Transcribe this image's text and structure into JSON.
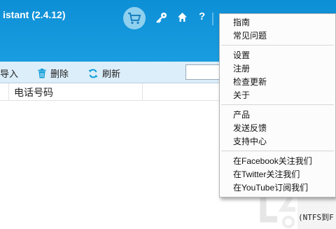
{
  "window": {
    "title": "istant (2.4.12)"
  },
  "header": {
    "icons": [
      "cart-icon",
      "key-icon",
      "home-icon",
      "help-icon"
    ],
    "help_label": "?"
  },
  "toolbar": {
    "import_label": "导入",
    "delete_label": "删除",
    "refresh_label": "刷新"
  },
  "table": {
    "columns": [
      "电话号码"
    ]
  },
  "menu": {
    "groups": [
      [
        "指南",
        "常见问题"
      ],
      [
        "设置",
        "注册",
        "检查更新",
        "关于"
      ],
      [
        "产品",
        "发送反馈",
        "支持中心"
      ],
      [
        "在Facebook关注我们",
        "在Twitter关注我们",
        "在YouTube订阅我们"
      ]
    ]
  },
  "background": {
    "partial_text": "(NTFS到F"
  },
  "colors": {
    "title_bar": "#0d8fd6",
    "toolbar": "#dceefa",
    "accent_icon": "#0e9fd8"
  }
}
